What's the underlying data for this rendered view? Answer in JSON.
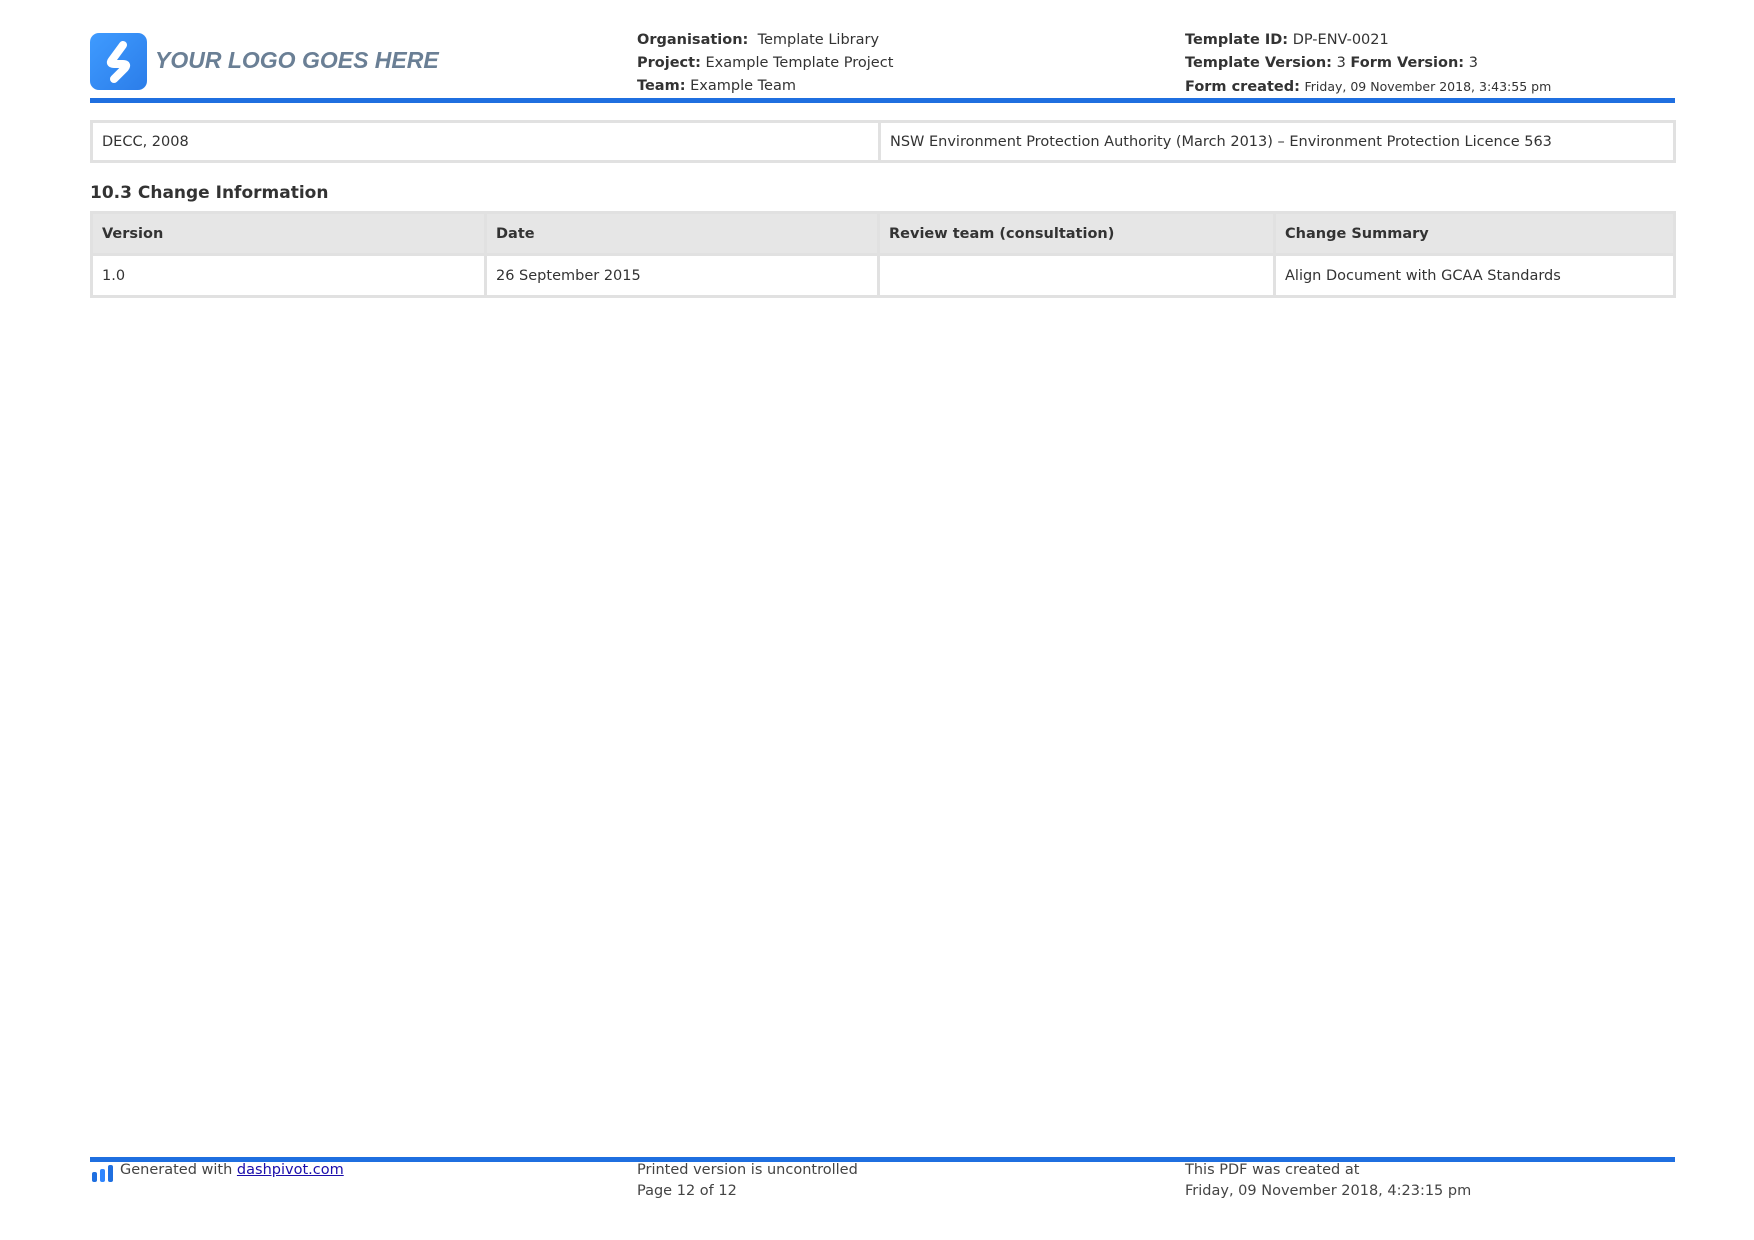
{
  "header": {
    "logo_text": "YOUR LOGO GOES HERE",
    "organisation_label": "Organisation:",
    "organisation_value": "Template Library",
    "project_label": "Project:",
    "project_value": "Example Template Project",
    "team_label": "Team:",
    "team_value": "Example Team",
    "template_id_label": "Template ID:",
    "template_id_value": "DP-ENV-0021",
    "template_version_label": "Template Version:",
    "template_version_value": "3",
    "form_version_label": "Form Version:",
    "form_version_value": "3",
    "form_created_label": "Form created:",
    "form_created_value": "Friday, 09 November 2018, 3:43:55 pm"
  },
  "references_table": {
    "rows": [
      [
        "DECC, 2008",
        "NSW Environment Protection Authority (March 2013) – Environment Protection Licence 563"
      ]
    ]
  },
  "change_info": {
    "title": "10.3 Change Information",
    "columns": [
      "Version",
      "Date",
      "Review team (consultation)",
      "Change Summary"
    ],
    "rows": [
      [
        "1.0",
        "26 September 2015",
        "",
        "Align Document with GCAA Standards"
      ]
    ]
  },
  "footer": {
    "generated_prefix": "Generated with",
    "generated_link": "dashpivot.com",
    "uncontrolled_text": "Printed version is uncontrolled",
    "page_text": "Page 12 of 12",
    "created_text": "This PDF was created at",
    "created_date": "Friday, 09 November 2018, 4:23:15 pm"
  },
  "colors": {
    "accent": "#1f6fe0",
    "logo_badge": "#3f9bff",
    "logo_text": "#6a7f95",
    "table_border": "#e1e1e1",
    "table_header_bg": "#e6e6e6"
  },
  "icons": {
    "logo": "logo-badge-icon",
    "footer": "dashpivot-bars-icon"
  }
}
